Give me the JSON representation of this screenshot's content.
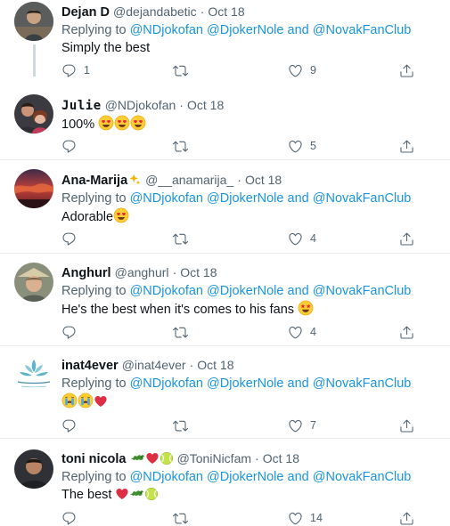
{
  "tweets": [
    {
      "name": "Dejan D",
      "handle": "@dejandabetic",
      "dot": "·",
      "time": "Oct 18",
      "replying_prefix": "Replying to",
      "mentions": [
        "@NDjokofan",
        "@DjokerNole",
        "and",
        "@NovakFanClub"
      ],
      "text": "Simply the best",
      "replies": "1",
      "retweets": "",
      "likes": "9"
    },
    {
      "name": "Julie",
      "handle": "@NDjokofan",
      "dot": "·",
      "time": "Oct 18",
      "text": "100%",
      "replies": "",
      "retweets": "",
      "likes": "5"
    },
    {
      "name": "Ana-Marija",
      "handle": "@__anamarija_",
      "dot": "·",
      "time": "Oct 18",
      "replying_prefix": "Replying to",
      "mentions": [
        "@NDjokofan",
        "@DjokerNole",
        "and",
        "@NovakFanClub"
      ],
      "text": "Adorable",
      "replies": "",
      "retweets": "",
      "likes": "4"
    },
    {
      "name": "Anghurl",
      "handle": "@anghurl",
      "dot": "·",
      "time": "Oct 18",
      "replying_prefix": "Replying to",
      "mentions": [
        "@NDjokofan",
        "@DjokerNole",
        "and",
        "@NovakFanClub"
      ],
      "text": "He's the best when it's comes to his fans",
      "replies": "",
      "retweets": "",
      "likes": "4"
    },
    {
      "name": "inat4ever",
      "handle": "@inat4ever",
      "dot": "·",
      "time": "Oct 18",
      "replying_prefix": "Replying to",
      "mentions": [
        "@NDjokofan",
        "@DjokerNole",
        "and",
        "@NovakFanClub"
      ],
      "text": "",
      "replies": "",
      "retweets": "",
      "likes": "7"
    },
    {
      "name": "toni nicola",
      "handle": "@ToniNicfam",
      "dot": "·",
      "time": "Oct 18",
      "replying_prefix": "Replying to",
      "mentions": [
        "@NDjokofan",
        "@DjokerNole",
        "and",
        "@NovakFanClub"
      ],
      "text": "The best",
      "replies": "",
      "retweets": "",
      "likes": "14"
    }
  ],
  "colors": {
    "mention": "#1b95e0",
    "muted": "#536471",
    "divider": "#e6ecf0"
  },
  "icons": [
    "reply-icon",
    "retweet-icon",
    "like-icon",
    "share-icon",
    "sparkles-icon",
    "heart-eyes-emoji",
    "star-struck-emoji",
    "crying-emoji",
    "red-heart-icon",
    "crocodile-icon",
    "tennis-ball-icon"
  ]
}
